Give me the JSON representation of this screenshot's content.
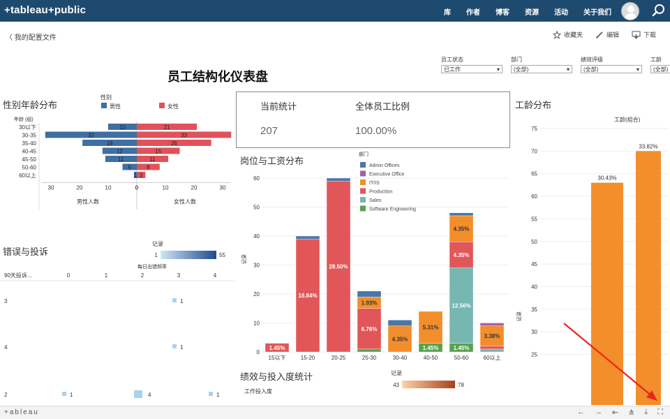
{
  "nav": {
    "logo": "+tableau+public",
    "links": [
      "库",
      "作者",
      "博客",
      "资源",
      "活动",
      "关于我们"
    ]
  },
  "sub": {
    "back": "〈 我的配置文件",
    "actions": [
      "收藏夹",
      "编辑",
      "下载"
    ]
  },
  "dashboard": {
    "title": "员工结构化仪表盘"
  },
  "filters": [
    {
      "label": "员工状态",
      "value": "已工作"
    },
    {
      "label": "部门",
      "value": "(全部)"
    },
    {
      "label": "绩效评级",
      "value": "(全部)"
    },
    {
      "label": "工龄",
      "value": "(全部)"
    }
  ],
  "kpi": {
    "current_label": "当前统计",
    "current_value": "207",
    "ratio_label": "全体员工比例",
    "ratio_value": "100.00%"
  },
  "sections": {
    "gender_age": "性别年龄分布",
    "errors": "错误与投诉",
    "position_salary": "岗位与工资分布",
    "tenure": "工龄分布",
    "performance": "绩效与投入度统计"
  },
  "bottom": {
    "brand": "+ableau"
  },
  "colors": {
    "male": "#3f6fa3",
    "female": "#e0525a",
    "admin": "#4a76a8",
    "exec": "#a361a5",
    "it": "#f28e2b",
    "prod": "#e15759",
    "sales": "#76b7b2",
    "swe": "#59a14f",
    "tenure": "#f28e2b"
  },
  "chart_data": [
    {
      "type": "bar",
      "chart": "gender-age-pyramid",
      "legend_title": "性别",
      "legend": [
        "男性",
        "女性"
      ],
      "ylabel": "年龄 (组)",
      "categories": [
        "30以下",
        "30-35",
        "35-40",
        "40-45",
        "45-50",
        "50-60",
        "60以上"
      ],
      "series": [
        {
          "name": "男性",
          "values": [
            10,
            32,
            19,
            12,
            11,
            5,
            1
          ]
        },
        {
          "name": "女性",
          "values": [
            21,
            33,
            26,
            15,
            11,
            8,
            3
          ]
        }
      ],
      "xticks_left": [
        "30",
        "20",
        "10",
        "0"
      ],
      "xticks_right": [
        "0",
        "10",
        "20",
        "30"
      ],
      "xlabel_left": "男性人数",
      "xlabel_right": "女性人数"
    },
    {
      "type": "table",
      "chart": "errors-complaints",
      "legend_title": "记录",
      "legend_min": "1",
      "legend_max": "55",
      "col_header": "每日出错频率",
      "row_header": "90天投诉...",
      "columns": [
        "0",
        "1",
        "2",
        "3",
        "4"
      ],
      "rows": [
        "3",
        "4",
        "2"
      ],
      "cells": [
        {
          "row": "3",
          "col": 3,
          "value": "1"
        },
        {
          "row": "4",
          "col": 3,
          "value": "1"
        },
        {
          "row": "2",
          "col": 0,
          "value": "1"
        },
        {
          "row": "2",
          "col": 2,
          "value": "4"
        },
        {
          "row": "2",
          "col": 4,
          "value": "1"
        }
      ]
    },
    {
      "type": "bar",
      "chart": "position-salary-stacked",
      "legend_title": "部门",
      "legend": [
        "Admin Offices",
        "Executive Office",
        "IT/IS",
        "Production",
        "Sales",
        "Software Engineering"
      ],
      "ylabel": "记录",
      "ylim": [
        0,
        60
      ],
      "yticks": [
        0,
        10,
        20,
        30,
        40,
        50,
        60
      ],
      "categories": [
        "15以下",
        "15-20",
        "20-25",
        "25-30",
        "30-40",
        "40-50",
        "50-60",
        "60以上"
      ],
      "stacks": [
        [
          {
            "dept": "Production",
            "v": 3,
            "label": "1.45%"
          }
        ],
        [
          {
            "dept": "Production",
            "v": 39,
            "label": "18.84%"
          },
          {
            "dept": "Admin Offices",
            "v": 1
          }
        ],
        [
          {
            "dept": "Production",
            "v": 59,
            "label": "28.50%"
          },
          {
            "dept": "Admin Offices",
            "v": 1
          }
        ],
        [
          {
            "dept": "Software Engineering",
            "v": 1
          },
          {
            "dept": "Production",
            "v": 14,
            "label": "6.76%"
          },
          {
            "dept": "IT/IS",
            "v": 4,
            "label": "1.93%"
          },
          {
            "dept": "Admin Offices",
            "v": 2
          }
        ],
        [
          {
            "dept": "IT/IS",
            "v": 9,
            "label": "4.35%"
          },
          {
            "dept": "Admin Offices",
            "v": 2
          }
        ],
        [
          {
            "dept": "Software Engineering",
            "v": 3,
            "label": "1.45%"
          },
          {
            "dept": "IT/IS",
            "v": 11,
            "label": "5.31%"
          }
        ],
        [
          {
            "dept": "Software Engineering",
            "v": 3,
            "label": "1.45%"
          },
          {
            "dept": "Sales",
            "v": 26,
            "label": "12.56%"
          },
          {
            "dept": "Production",
            "v": 9,
            "label": "4.35%"
          },
          {
            "dept": "IT/IS",
            "v": 9,
            "label": "4.35%"
          },
          {
            "dept": "Admin Offices",
            "v": 1
          }
        ],
        [
          {
            "dept": "Sales",
            "v": 1
          },
          {
            "dept": "Production",
            "v": 1
          },
          {
            "dept": "IT/IS",
            "v": 7,
            "label": "3.38%"
          },
          {
            "dept": "Executive Office",
            "v": 1
          }
        ]
      ]
    },
    {
      "type": "bar",
      "chart": "tenure-distribution",
      "series_label": "工龄(组合)",
      "ylabel": "记录",
      "yticks": [
        25,
        30,
        35,
        40,
        45,
        50,
        55,
        60,
        65,
        70,
        75
      ],
      "values": [
        63,
        70
      ],
      "labels": [
        "30.43%",
        "33.82%"
      ]
    },
    {
      "type": "bar",
      "chart": "performance-engagement",
      "row_header": "工作投入度",
      "legend_title": "记录",
      "legend_min": "43",
      "legend_max": "78"
    }
  ]
}
